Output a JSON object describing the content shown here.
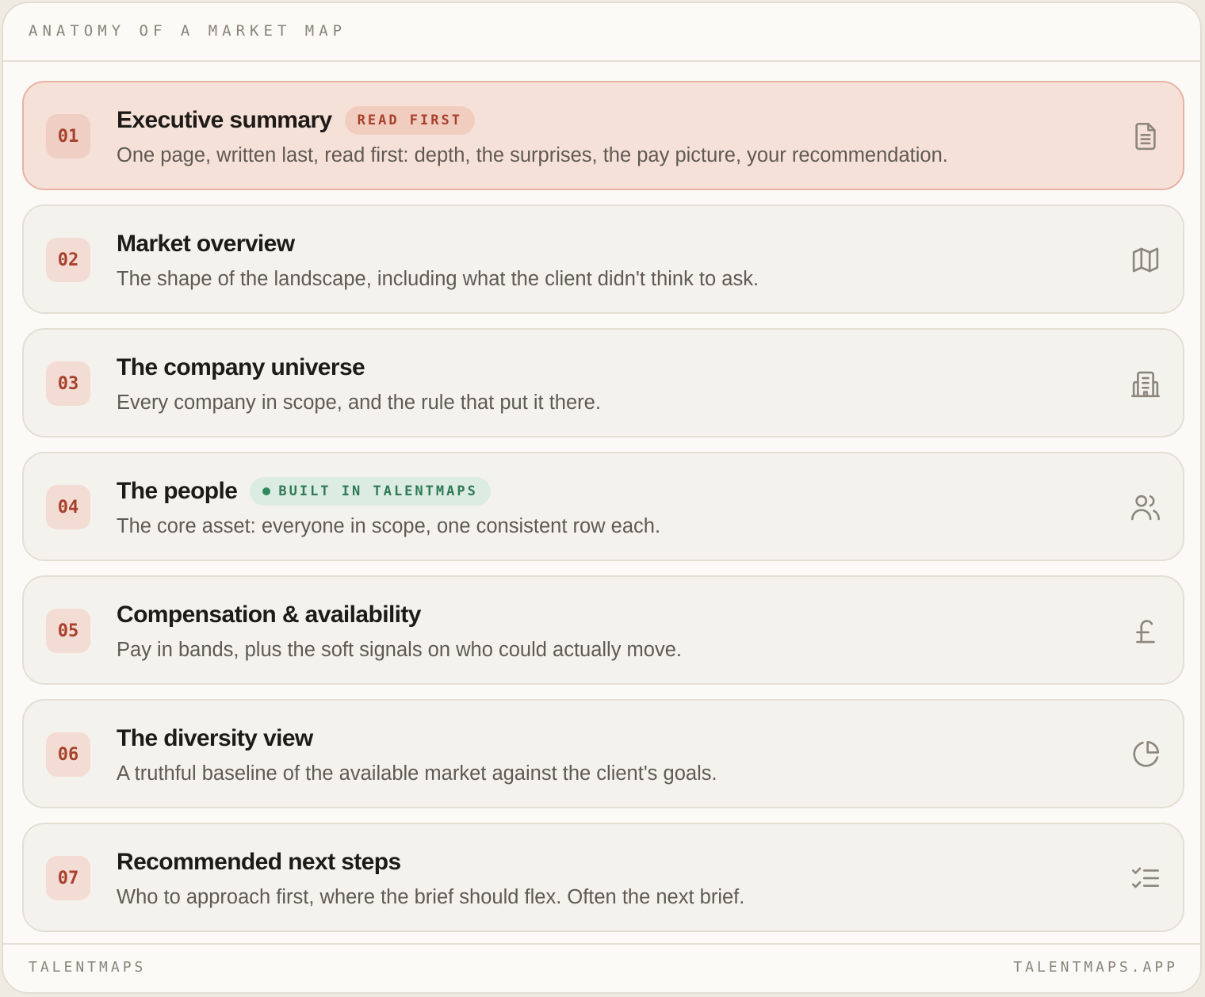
{
  "header": {
    "eyebrow": "ANATOMY OF A MARKET MAP"
  },
  "sections": [
    {
      "number": "01",
      "title": "Executive summary",
      "badge": "READ FIRST",
      "description": "One page, written last, read first: depth, the surprises, the pay picture, your recommendation.",
      "icon": "document-icon"
    },
    {
      "number": "02",
      "title": "Market overview",
      "description": "The shape of the landscape, including what the client didn't think to ask.",
      "icon": "map-icon"
    },
    {
      "number": "03",
      "title": "The company universe",
      "description": "Every company in scope, and the rule that put it there.",
      "icon": "building-icon"
    },
    {
      "number": "04",
      "title": "The people",
      "badge": "BUILT IN TALENTMAPS",
      "description": "The core asset: everyone in scope, one consistent row each.",
      "icon": "users-icon"
    },
    {
      "number": "05",
      "title": "Compensation & availability",
      "description": "Pay in bands, plus the soft signals on who could actually move.",
      "icon": "pound-icon"
    },
    {
      "number": "06",
      "title": "The diversity view",
      "description": "A truthful baseline of the available market against the client's goals.",
      "icon": "pie-chart-icon"
    },
    {
      "number": "07",
      "title": "Recommended next steps",
      "description": "Who to approach first, where the brief should flex. Often the next brief.",
      "icon": "checklist-icon"
    }
  ],
  "footer": {
    "brand": "TALENTMAPS",
    "url": "TALENTMAPS.APP"
  },
  "colors": {
    "accent": "#a8402c",
    "highlight_bg": "#f6e1d8",
    "badge_green": "#2e7a55",
    "background": "#fbfaf6"
  }
}
